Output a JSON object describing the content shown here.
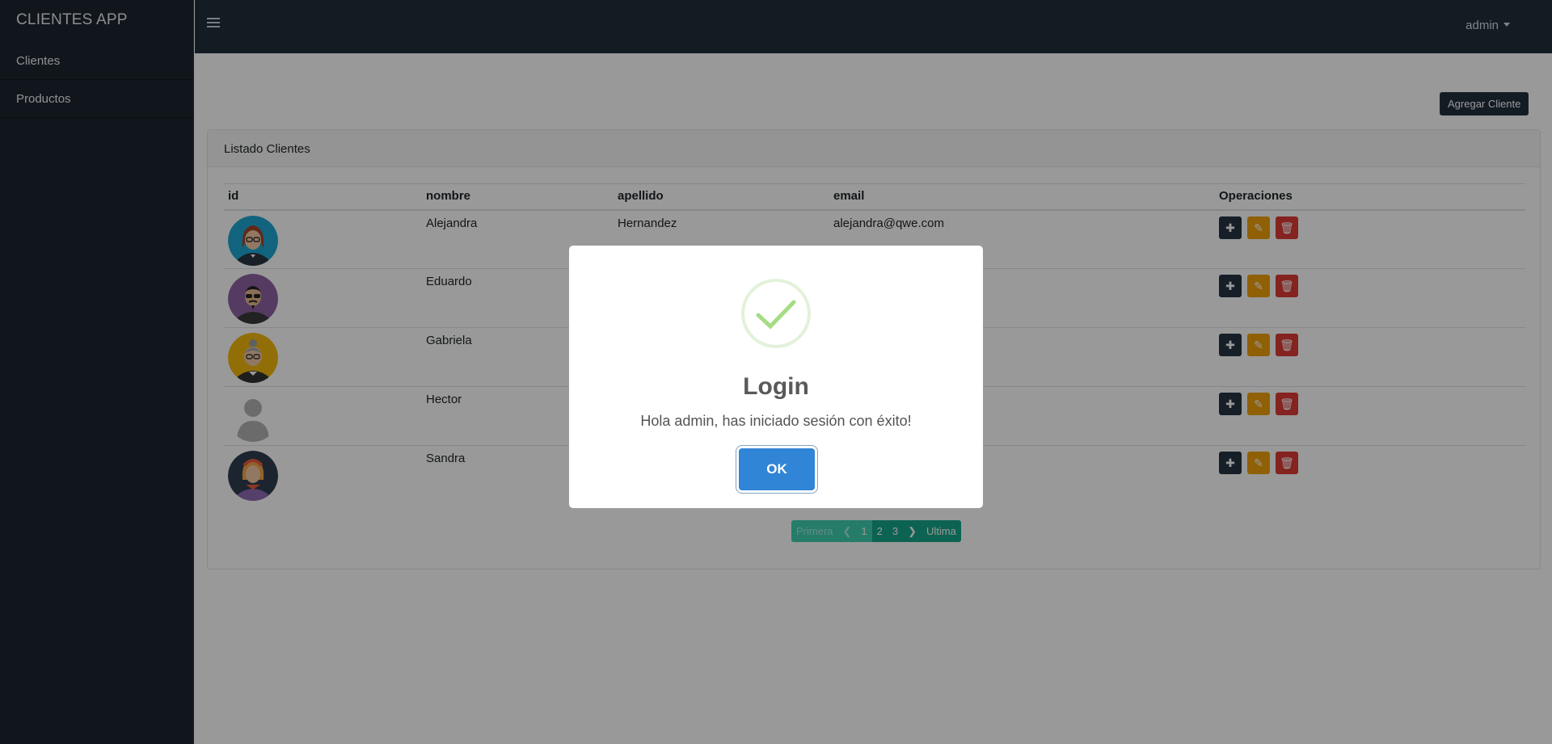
{
  "app": {
    "brand": "CLIENTES APP"
  },
  "sidebar": {
    "items": [
      {
        "label": "Clientes"
      },
      {
        "label": "Productos"
      }
    ]
  },
  "topbar": {
    "user": "admin"
  },
  "main": {
    "add_button": "Agregar Cliente",
    "card_title": "Listado Clientes",
    "table": {
      "headers": [
        "id",
        "nombre",
        "apellido",
        "email",
        "Operaciones"
      ],
      "rows": [
        {
          "nombre": "Alejandra",
          "apellido": "Hernandez",
          "email": "alejandra@qwe.com",
          "avatar": "woman-glasses-avatar"
        },
        {
          "nombre": "Eduardo",
          "apellido": "",
          "email": "",
          "avatar": "man-sunglasses-avatar"
        },
        {
          "nombre": "Gabriela",
          "apellido": "",
          "email": "",
          "avatar": "grandma-avatar"
        },
        {
          "nombre": "Hector",
          "apellido": "",
          "email": "",
          "avatar": "default-user-avatar"
        },
        {
          "nombre": "Sandra",
          "apellido": "",
          "email": "",
          "avatar": "woman-scarf-avatar"
        }
      ]
    },
    "pagination": {
      "first": "Primera",
      "pages": [
        "1",
        "2",
        "3"
      ],
      "last": "Ultima",
      "current": "1"
    }
  },
  "modal": {
    "title": "Login",
    "text": "Hola admin, has iniciado sesión con éxito!",
    "confirm": "OK",
    "icon": "success-check-icon"
  },
  "colors": {
    "sidebar_bg": "#1b2530",
    "topbar_bg": "#212d3b",
    "ok_button": "#3085d6",
    "success": "#a5dc86",
    "pager": "#17a589",
    "edit": "#f1a00a",
    "delete": "#dc3b35"
  }
}
